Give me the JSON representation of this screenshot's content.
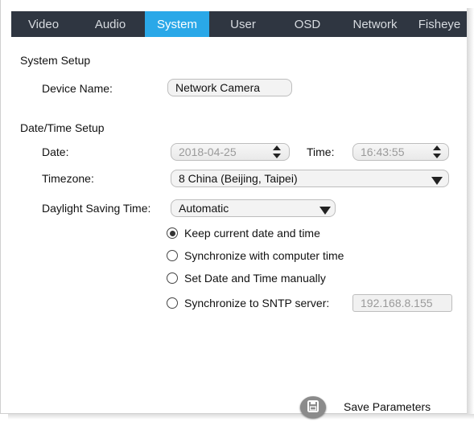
{
  "tabs": [
    {
      "label": "Video",
      "active": false
    },
    {
      "label": "Audio",
      "active": false
    },
    {
      "label": "System",
      "active": true
    },
    {
      "label": "User",
      "active": false
    },
    {
      "label": "OSD",
      "active": false
    },
    {
      "label": "Network",
      "active": false
    },
    {
      "label": "Fisheye",
      "active": false
    }
  ],
  "system_setup": {
    "heading": "System Setup",
    "device_name_label": "Device Name:",
    "device_name_value": "Network Camera"
  },
  "datetime_setup": {
    "heading": "Date/Time Setup",
    "date_label": "Date:",
    "date_value": "2018-04-25",
    "time_label": "Time:",
    "time_value": "16:43:55",
    "timezone_label": "Timezone:",
    "timezone_value": "8 China (Beijing, Taipei)",
    "dst_label": "Daylight Saving Time:",
    "dst_value": "Automatic",
    "options": [
      {
        "label": "Keep current date and time",
        "checked": true
      },
      {
        "label": "Synchronize with computer time",
        "checked": false
      },
      {
        "label": "Set Date and Time manually",
        "checked": false
      },
      {
        "label": "Synchronize to SNTP server:",
        "checked": false
      }
    ],
    "sntp_server_value": "192.168.8.155"
  },
  "footer": {
    "save_label": "Save Parameters",
    "save_icon": "floppy-disk-icon"
  },
  "colors": {
    "tabbar_bg": "#2f3641",
    "tab_active_bg": "#2aa8e8",
    "save_icon_bg": "#8b8b8b"
  }
}
